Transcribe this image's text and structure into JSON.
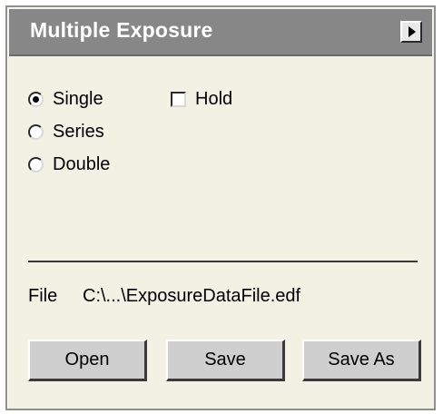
{
  "window": {
    "title": "Multiple Exposure",
    "menu_button_icon": "right-arrow-icon"
  },
  "mode": {
    "options": [
      {
        "label": "Single",
        "selected": true
      },
      {
        "label": "Series",
        "selected": false
      },
      {
        "label": "Double",
        "selected": false
      }
    ],
    "hold": {
      "label": "Hold",
      "checked": false
    }
  },
  "file": {
    "label": "File",
    "path": "C:\\...\\ExposureDataFile.edf"
  },
  "buttons": {
    "open": "Open",
    "save": "Save",
    "save_as": "Save As"
  },
  "colors": {
    "title_bar": "#878787",
    "panel_background": "#f1f1e4",
    "button_face": "#cfcfcf"
  }
}
